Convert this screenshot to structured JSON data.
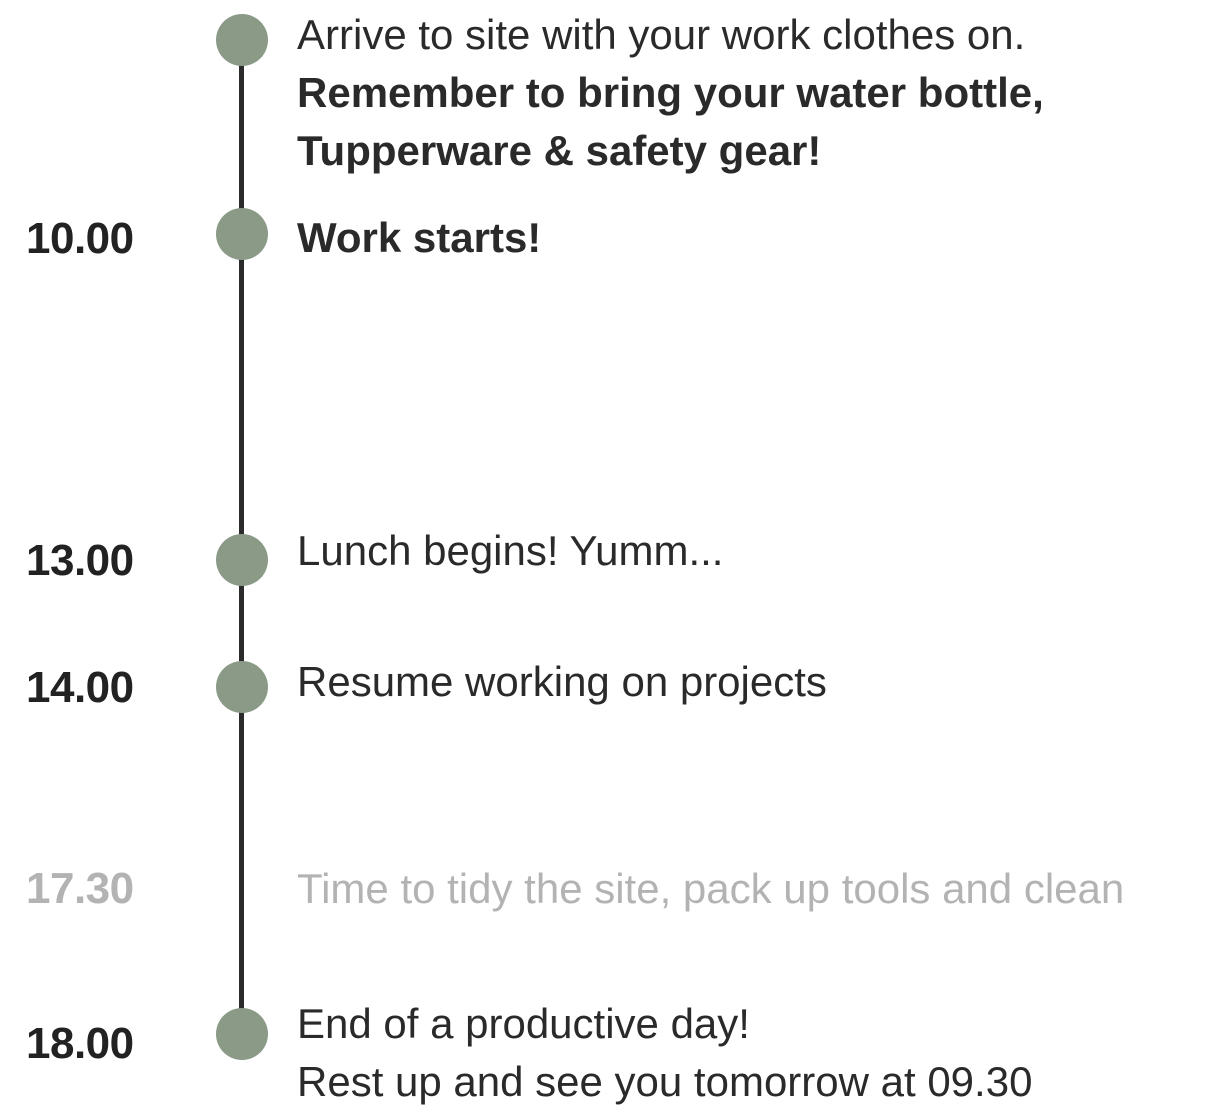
{
  "schedule": {
    "arrival": {
      "line1": "Arrive to site with your work clothes on.",
      "line2": "Remember to bring your water bottle,",
      "line3": "Tupperware & safety gear!"
    },
    "work_start": {
      "time": "10.00",
      "text": "Work starts!"
    },
    "lunch": {
      "time": "13.00",
      "text": "Lunch begins! Yumm..."
    },
    "resume": {
      "time": "14.00",
      "text": "Resume working on projects"
    },
    "tidy": {
      "time": "17.30",
      "text": "Time to tidy the site, pack up tools and clean"
    },
    "end": {
      "time": "18.00",
      "line1": "End of a productive day!",
      "line2": "Rest up and see you tomorrow at 09.30"
    }
  },
  "colors": {
    "dot": "#8a9a87",
    "line": "#2b2b2b",
    "muted_text": "#b3b3b3"
  }
}
